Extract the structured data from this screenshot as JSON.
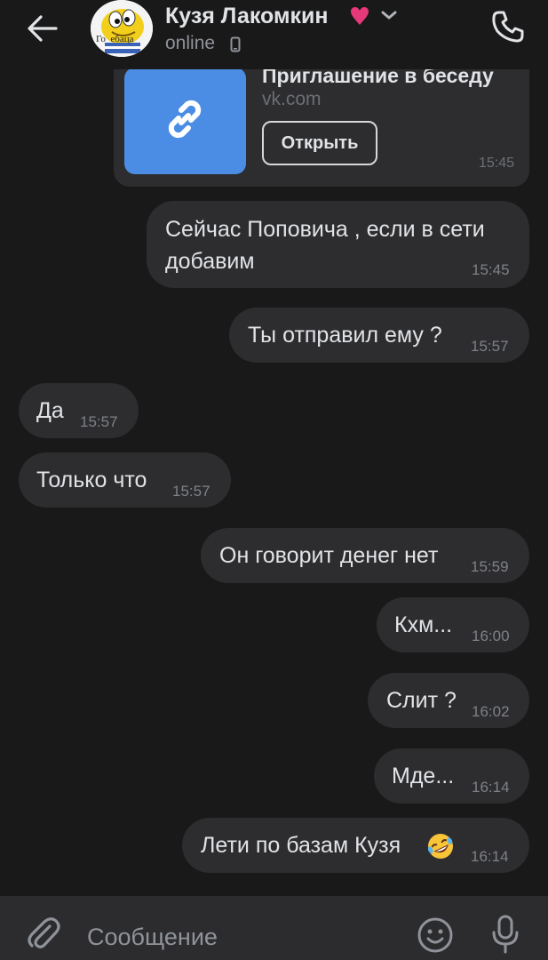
{
  "header": {
    "name": "Кузя Лакомкин",
    "status": "online",
    "avatar_text": "Го  ебаца",
    "heart_color": "#e6397a"
  },
  "link_card": {
    "title": "Приглашение в беседу",
    "domain": "vk.com",
    "button_label": "Открыть",
    "time": "15:45",
    "thumb_color": "#4b8de4"
  },
  "messages": [
    {
      "text_line1": "Сейчас Поповича , если в сети",
      "text_line2": "добавим",
      "time": "15:45",
      "direction": "outgoing"
    },
    {
      "text": "Ты отправил ему ?",
      "time": "15:57",
      "direction": "outgoing"
    },
    {
      "text": "Да",
      "time": "15:57",
      "direction": "incoming"
    },
    {
      "text": "Только что",
      "time": "15:57",
      "direction": "incoming"
    },
    {
      "text": "Он говорит денег нет",
      "time": "15:59",
      "direction": "outgoing"
    },
    {
      "text": "Кхм...",
      "time": "16:00",
      "direction": "outgoing"
    },
    {
      "text": "Слит ?",
      "time": "16:02",
      "direction": "outgoing"
    },
    {
      "text": "Мде...",
      "time": "16:14",
      "direction": "outgoing"
    },
    {
      "text": "Лети по базам Кузя",
      "emoji": "rolling-on-floor-laughing-icon",
      "time": "16:14",
      "direction": "outgoing"
    }
  ],
  "composer": {
    "placeholder": "Сообщение"
  }
}
